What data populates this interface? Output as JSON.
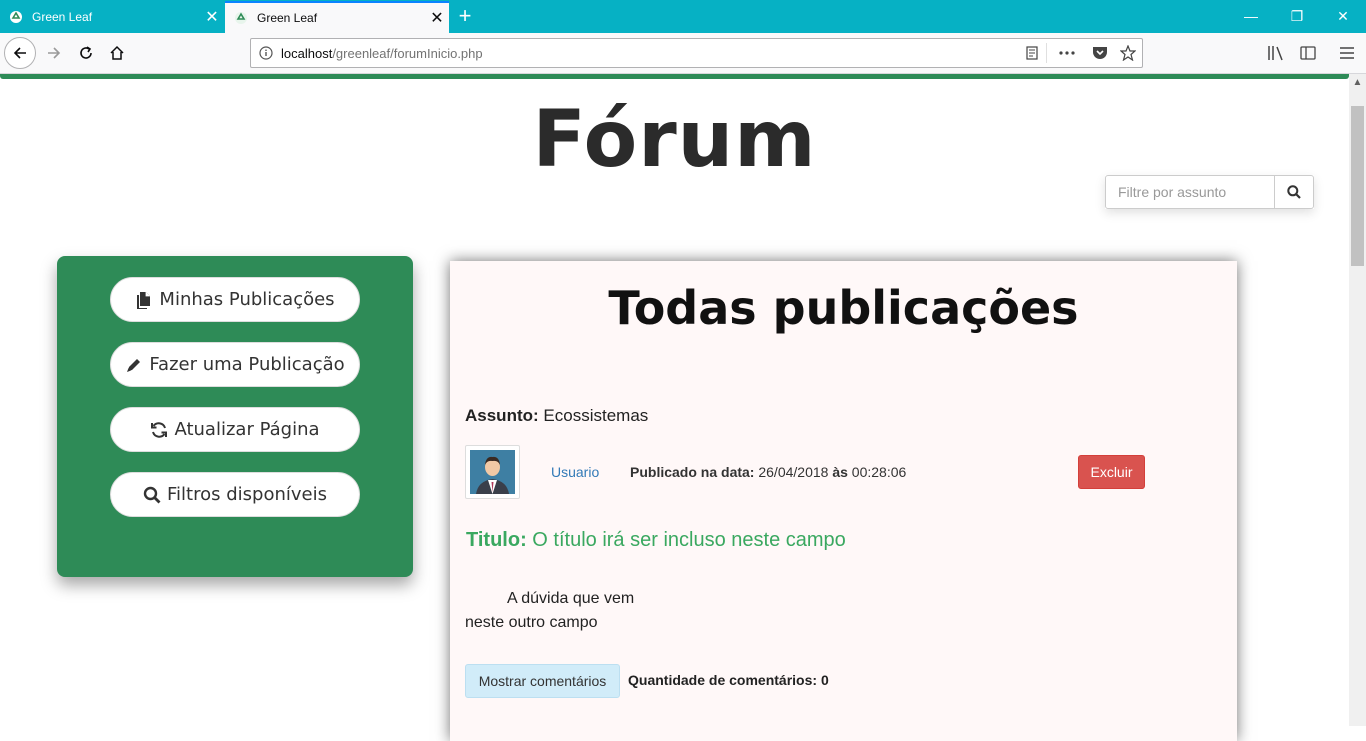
{
  "browser": {
    "tabs": [
      {
        "title": "Green Leaf",
        "active": false
      },
      {
        "title": "Green Leaf",
        "active": true
      }
    ],
    "url_host": "localhost",
    "url_path": "/greenleaf/forumInicio.php",
    "accent_color": "#06b1c4"
  },
  "page": {
    "title": "Fórum",
    "search_placeholder": "Filtre por assunto",
    "brand_color": "#2e8b57"
  },
  "sidebar": {
    "items": [
      {
        "label": "Minhas Publicações",
        "icon": "file-icon"
      },
      {
        "label": "Fazer uma Publicação",
        "icon": "pencil-icon"
      },
      {
        "label": "Atualizar Página",
        "icon": "refresh-icon"
      },
      {
        "label": "Filtros disponíveis",
        "icon": "search-icon"
      }
    ]
  },
  "main": {
    "heading": "Todas publicações",
    "post": {
      "subject_label": "Assunto:",
      "subject": "Ecossistemas",
      "user": "Usuario",
      "published_label": "Publicado na data:",
      "date": "26/04/2018",
      "at_label": "às",
      "time": "00:28:06",
      "delete_label": "Excluir",
      "title_label": "Titulo:",
      "title": "O título irá ser incluso neste campo",
      "body_line1": "A dúvida que vem",
      "body_line2": "neste outro campo",
      "show_comments_label": "Mostrar comentários",
      "comments_count_label": "Quantidade de comentários:",
      "comments_count": "0"
    }
  }
}
